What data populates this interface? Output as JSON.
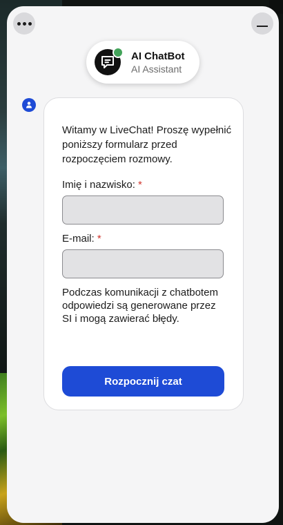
{
  "header": {
    "menu_icon": "more-horizontal-icon",
    "minimize_icon": "minimize-icon"
  },
  "agent": {
    "name": "AI ChatBot",
    "subtitle": "AI Assistant",
    "avatar_icon": "chatbot-icon",
    "status_color": "#43a35a"
  },
  "bot_badge_icon": "user-icon",
  "form": {
    "intro": "Witamy w LiveChat! Proszę wypełnić poniższy formularz przed rozpoczęciem rozmowy.",
    "name_label": "Imię i nazwisko:",
    "name_value": "",
    "email_label": "E-mail:",
    "email_value": "",
    "required_marker": "*",
    "disclaimer": "Podczas komunikacji z chatbotem odpowiedzi są generowane przez SI i mogą zawierać błędy.",
    "submit_label": "Rozpocznij czat"
  },
  "colors": {
    "accent": "#1e4bd6",
    "required": "#d0342c",
    "widget_bg": "#f5f5f6"
  }
}
